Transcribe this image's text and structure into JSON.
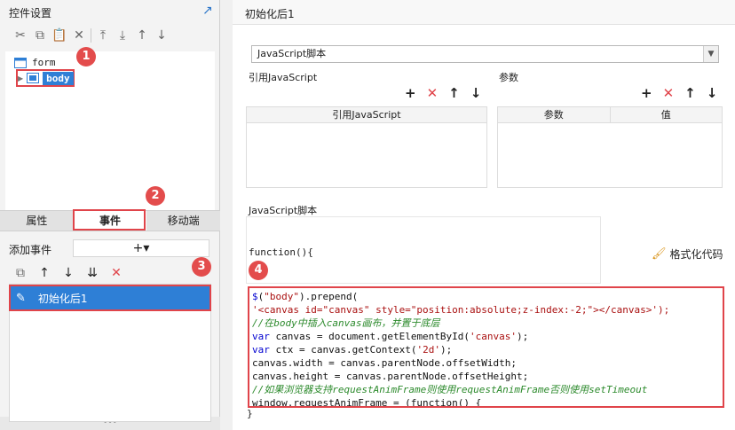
{
  "left_panel": {
    "title": "控件设置",
    "tree": {
      "form": "form",
      "body": "body"
    },
    "tabs": [
      "属性",
      "事件",
      "移动端"
    ],
    "add_event_label": "添加事件",
    "add_event_btn": "+▾",
    "event_item": "初始化后1"
  },
  "badges": [
    "1",
    "2",
    "3",
    "4"
  ],
  "right_panel": {
    "title": "初始化后1",
    "script_type": "JavaScript脚本",
    "ref_js_label": "引用JavaScript",
    "params_label": "参数",
    "ref_js_col": "引用JavaScript",
    "params_cols": [
      "参数",
      "值"
    ],
    "script_section_label": "JavaScript脚本",
    "function_open": "function(){",
    "format_code": "格式化代码",
    "closing_brace": "}"
  },
  "code_lines": [
    "$(\"body\").prepend(",
    "'<canvas id=\"canvas\" style=\"position:absolute;z-index:-2;\"></canvas>');",
    "//在body中插入canvas画布，并置于底层",
    "var canvas = document.getElementById('canvas');",
    "var ctx = canvas.getContext('2d');",
    "canvas.width = canvas.parentNode.offsetWidth;",
    "canvas.height = canvas.parentNode.offsetHeight;",
    "//如果浏览器支持requestAnimFrame则使用requestAnimFrame否则使用setTimeout",
    "window.requestAnimFrame = (function() {"
  ]
}
